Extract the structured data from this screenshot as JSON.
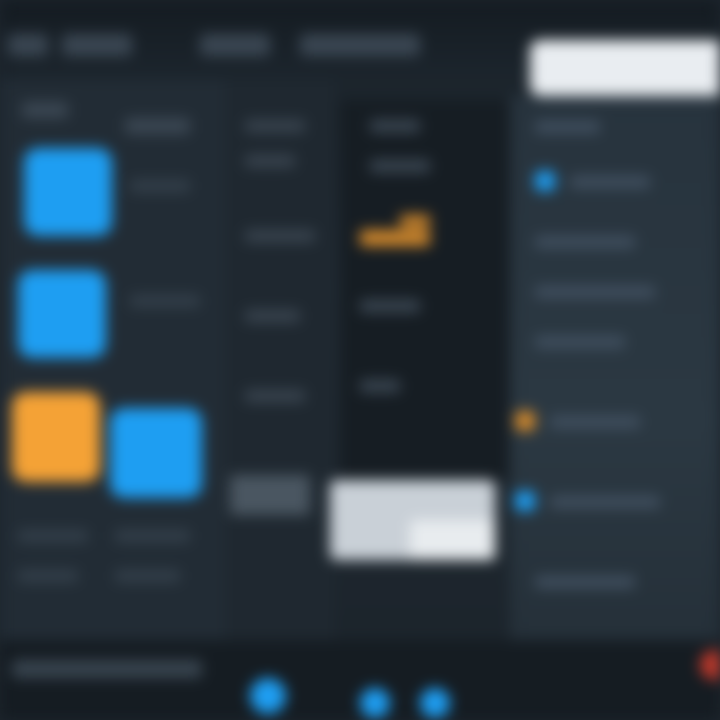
{
  "window": {
    "title": "",
    "accent_blue": "#1e9ef2",
    "accent_orange": "#f4a236",
    "background": "#1d252d"
  },
  "menubar": {
    "items": [
      "",
      "",
      "",
      ""
    ],
    "search": {
      "value": "",
      "placeholder": ""
    }
  },
  "left_panel": {
    "tiles": [
      {
        "icon": "app-tile-icon",
        "color": "#1e9ef2",
        "label": ""
      },
      {
        "icon": "app-tile-icon",
        "color": "#1e9ef2",
        "label": ""
      },
      {
        "icon": "app-tile-icon",
        "color": "#f4a236",
        "label": ""
      },
      {
        "icon": "app-tile-icon",
        "color": "#1e9ef2",
        "label": ""
      }
    ]
  },
  "editor": {
    "accent_color": "#d48a2c"
  },
  "right_panel": {
    "highlight_colors": [
      "#1e9ef2",
      "#d48a2c",
      "#1e9ef2"
    ]
  },
  "bottombar": {
    "status_text": "",
    "icon_colors": [
      "#1e9ef2",
      "#1e9ef2",
      "#1e9ef2"
    ]
  },
  "note": ""
}
